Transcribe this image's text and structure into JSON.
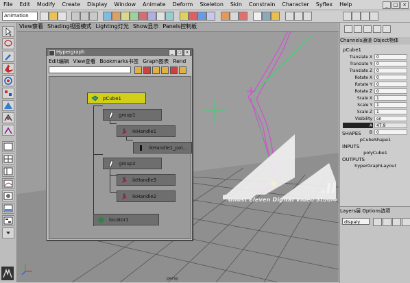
{
  "menubar": {
    "items": [
      "File",
      "Edit",
      "Modify",
      "Create",
      "Display",
      "Window",
      "Animate",
      "Deform",
      "Skeleton",
      "Skin",
      "Constrain",
      "Character",
      "Syflex",
      "Help"
    ]
  },
  "toolbar": {
    "mode": "Animation"
  },
  "viewport": {
    "menu": [
      "View察看",
      "Shading视图模式",
      "Lighting灯光",
      "Show显示",
      "Panels控制板"
    ],
    "camera_label": "persp"
  },
  "hypergraph": {
    "title": "Hypergraph",
    "menu": [
      "Edit编辑",
      "View查看",
      "Bookmarks书签",
      "Graph图表",
      "Rend"
    ],
    "nodes": {
      "pCube1": "pCube1",
      "group1": "group1",
      "ikHandle1": "ikHandle1",
      "ikHandle1_pol": "ikHandle1_pol...",
      "group2": "group2",
      "ikHandle3": "ikHandle3",
      "ikHandle2": "ikHandle2",
      "locator1": "locator1"
    }
  },
  "channelbox": {
    "menu": "Channels通道   Object物体",
    "object": "pCube1",
    "attributes": [
      {
        "name": "Translate X",
        "value": "0"
      },
      {
        "name": "Translate Y",
        "value": "0"
      },
      {
        "name": "Translate Z",
        "value": "0"
      },
      {
        "name": "Rotate X",
        "value": "0"
      },
      {
        "name": "Rotate Y",
        "value": "0"
      },
      {
        "name": "Rotate Z",
        "value": "0"
      },
      {
        "name": "Scale X",
        "value": "1"
      },
      {
        "name": "Scale Y",
        "value": "1"
      },
      {
        "name": "Scale Z",
        "value": "1"
      },
      {
        "name": "Visibility",
        "value": "on"
      },
      {
        "name": "A",
        "value": "47.9"
      },
      {
        "name": "B",
        "value": "0"
      }
    ],
    "shapes_title": "SHAPES",
    "shapes_item": "pCubeShape1",
    "inputs_title": "INPUTS",
    "inputs_item": "polyCube1",
    "outputs_title": "OUTPUTS",
    "outputs_item": "hyperGraphLayout"
  },
  "layers": {
    "menu": "Layers层   Options选项",
    "display": "dispaly"
  },
  "watermark": {
    "text": "Ghost Eleven Digital Video Studio",
    "logo_text": ".II"
  },
  "colors": {
    "selected_node": "#d2cf18",
    "rig": "#d050d0"
  }
}
